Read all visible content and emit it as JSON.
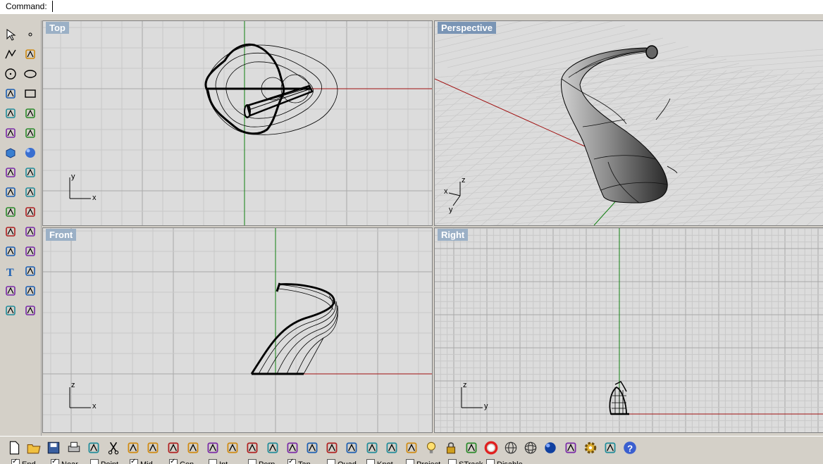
{
  "command": {
    "label": "Command:",
    "value": ""
  },
  "viewports": [
    {
      "key": "top",
      "title": "Top",
      "active": false,
      "axes": [
        "y",
        "x"
      ]
    },
    {
      "key": "perspective",
      "title": "Perspective",
      "active": true,
      "axes": [
        "z",
        "x",
        "y"
      ]
    },
    {
      "key": "front",
      "title": "Front",
      "active": false,
      "axes": [
        "z",
        "x"
      ]
    },
    {
      "key": "right",
      "title": "Right",
      "active": false,
      "axes": [
        "z",
        "y"
      ]
    }
  ],
  "left_toolbar": [
    "select-arrow-icon",
    "point-icon",
    "polyline-icon",
    "curve-cv-icon",
    "circle-icon",
    "ellipse-icon",
    "polygon-icon",
    "rectangle-icon",
    "curve-tools-icon",
    "fillet-curve-icon",
    "surface-icon",
    "surface-edit-icon",
    "solid-box-icon",
    "sphere-icon",
    "extrude-icon",
    "surface-from-curves-icon",
    "transform-icon",
    "explode-icon",
    "trim-icon",
    "split-icon",
    "boolean-icon",
    "solid-tools-icon",
    "join-curve-icon",
    "offset-icon",
    "text-icon",
    "scale-icon",
    "array-icon",
    "dimension-icon",
    "block-icon",
    "mesh-icon"
  ],
  "bottom_toolbar": [
    "new-file-icon",
    "open-file-icon",
    "save-icon",
    "print-icon",
    "import-icon",
    "cut-icon",
    "copy-icon",
    "paste-icon",
    "undo-icon",
    "pan-hand-icon",
    "rotate-view-icon",
    "zoom-icon",
    "zoom-window-icon",
    "zoom-extents-icon",
    "zoom-selected-icon",
    "undo-view-icon",
    "four-viewports-icon",
    "car-icon",
    "grid-plane-icon",
    "layer-icon",
    "properties-icon",
    "light-icon",
    "lock-icon",
    "render-icon",
    "color-wheel-icon",
    "wireframe-sphere-icon",
    "mesh-sphere-icon",
    "shaded-sphere-icon",
    "pen-icon",
    "options-gear-icon",
    "plugin-icon",
    "help-icon"
  ],
  "osnaps": [
    {
      "label": "End",
      "checked": true
    },
    {
      "label": "Near",
      "checked": true
    },
    {
      "label": "Point",
      "checked": false
    },
    {
      "label": "Mid",
      "checked": true
    },
    {
      "label": "Cen",
      "checked": true
    },
    {
      "label": "Int",
      "checked": false
    },
    {
      "label": "Perp",
      "checked": false
    },
    {
      "label": "Tan",
      "checked": true
    },
    {
      "label": "Quad",
      "checked": false
    },
    {
      "label": "Knot",
      "checked": false
    },
    {
      "label": "Project",
      "checked": false
    },
    {
      "label": "STrack",
      "checked": false
    },
    {
      "label": "Disable",
      "checked": false
    }
  ],
  "colors": {
    "viewport_bg": "#dcdcdc",
    "grid_minor": "#c8c8c8",
    "grid_major": "#a8a8a8",
    "x_axis": "#a01010",
    "y_axis": "#108010",
    "title_bg": "#9bb0c6"
  }
}
